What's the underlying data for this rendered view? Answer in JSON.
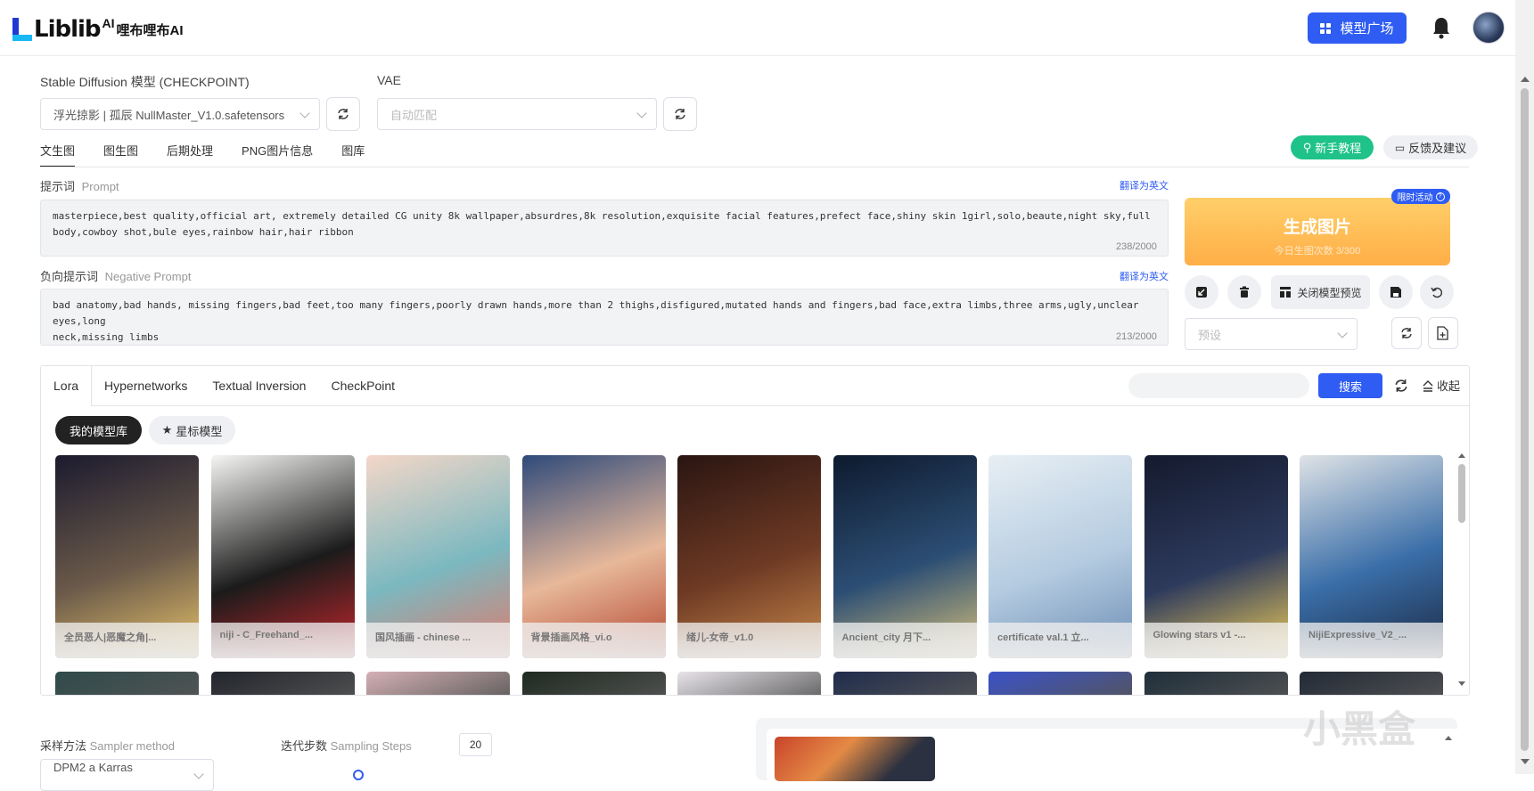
{
  "header": {
    "logo_text": "Liblib",
    "logo_ai": "AI",
    "logo_cn": "哩布哩布AI",
    "model_square_label": "模型广场"
  },
  "checkpoint": {
    "label_cn": "Stable Diffusion 模型",
    "label_en": "(CHECKPOINT)",
    "value": "浮光掠影 | 孤辰 NullMaster_V1.0.safetensors"
  },
  "vae": {
    "label": "VAE",
    "placeholder": "自动匹配"
  },
  "tabs": [
    "文生图",
    "图生图",
    "后期处理",
    "PNG图片信息",
    "图库"
  ],
  "tutorial_label": "新手教程",
  "feedback_label": "反馈及建议",
  "prompt": {
    "label_cn": "提示词",
    "label_en": "Prompt",
    "translate": "翻译为英文",
    "text": "masterpiece,best quality,official art, extremely detailed CG unity 8k wallpaper,absurdres,8k resolution,exquisite facial features,prefect face,shiny skin 1girl,solo,beaute,night sky,full\nbody,cowboy shot,bule eyes,rainbow hair,hair ribbon",
    "counter": "238/2000"
  },
  "negative": {
    "label_cn": "负向提示词",
    "label_en": "Negative Prompt",
    "translate": "翻译为英文",
    "text": "bad anatomy,bad hands, missing fingers,bad feet,too many fingers,poorly drawn hands,more than 2 thighs,disfigured,mutated hands and fingers,bad face,extra limbs,three arms,ugly,unclear eyes,long\nneck,missing limbs",
    "counter": "213/2000"
  },
  "generate": {
    "badge": "限时活动",
    "title": "生成图片",
    "subtitle": "今日生图次数 3/300"
  },
  "close_preview_label": "关闭模型预览",
  "preset_placeholder": "预设",
  "model_tabs": [
    "Lora",
    "Hypernetworks",
    "Textual Inversion",
    "CheckPoint"
  ],
  "search_button": "搜索",
  "collapse_label": "收起",
  "chips": {
    "my_library": "我的模型库",
    "starred": "星标模型"
  },
  "cards": [
    {
      "caption": "全员恶人|恶魔之角|...",
      "colors": [
        "#1b1a2e",
        "#6b5a4a",
        "#e8c36a"
      ]
    },
    {
      "caption": "niji - C_Freehand_...",
      "colors": [
        "#f6f6f4",
        "#1b1b1b",
        "#c8272d"
      ]
    },
    {
      "caption": "国风插画 - chinese ...",
      "colors": [
        "#f4d7c8",
        "#7bb8c0",
        "#e27a6b"
      ]
    },
    {
      "caption": "背景插画风格_vi.o",
      "colors": [
        "#2e4a7a",
        "#e7b89a",
        "#b3452e"
      ]
    },
    {
      "caption": "绪儿-女帝_v1.0",
      "colors": [
        "#2a1512",
        "#6e3a24",
        "#c98a4c"
      ]
    },
    {
      "caption": "Ancient_city 月下...",
      "colors": [
        "#0e1a2e",
        "#2c4e74",
        "#d9c27a"
      ]
    },
    {
      "caption": "certificate val.1 立...",
      "colors": [
        "#e8eff4",
        "#b4cbe0",
        "#6d8db5"
      ]
    },
    {
      "caption": "Glowing stars v1 -...",
      "colors": [
        "#141a2e",
        "#2d3a5c",
        "#f3cf5a"
      ]
    },
    {
      "caption": "NijiExpressive_V2_...",
      "colors": [
        "#dfe3e6",
        "#3a6ea8",
        "#1c2a44"
      ]
    }
  ],
  "row2_colors": [
    "#2f4a4a",
    "#22252c",
    "#d4b0b4",
    "#1e2a20",
    "#e8e4ea",
    "#1f2c4c",
    "#3b52c8",
    "#1e2e3a",
    "#222a36"
  ],
  "sampler": {
    "label_cn": "采样方法",
    "label_en": "Sampler method",
    "value": "DPM2 a Karras"
  },
  "steps": {
    "label_cn": "迭代步数",
    "label_en": "Sampling Steps",
    "value": "20"
  },
  "watermark": "小黑盒"
}
